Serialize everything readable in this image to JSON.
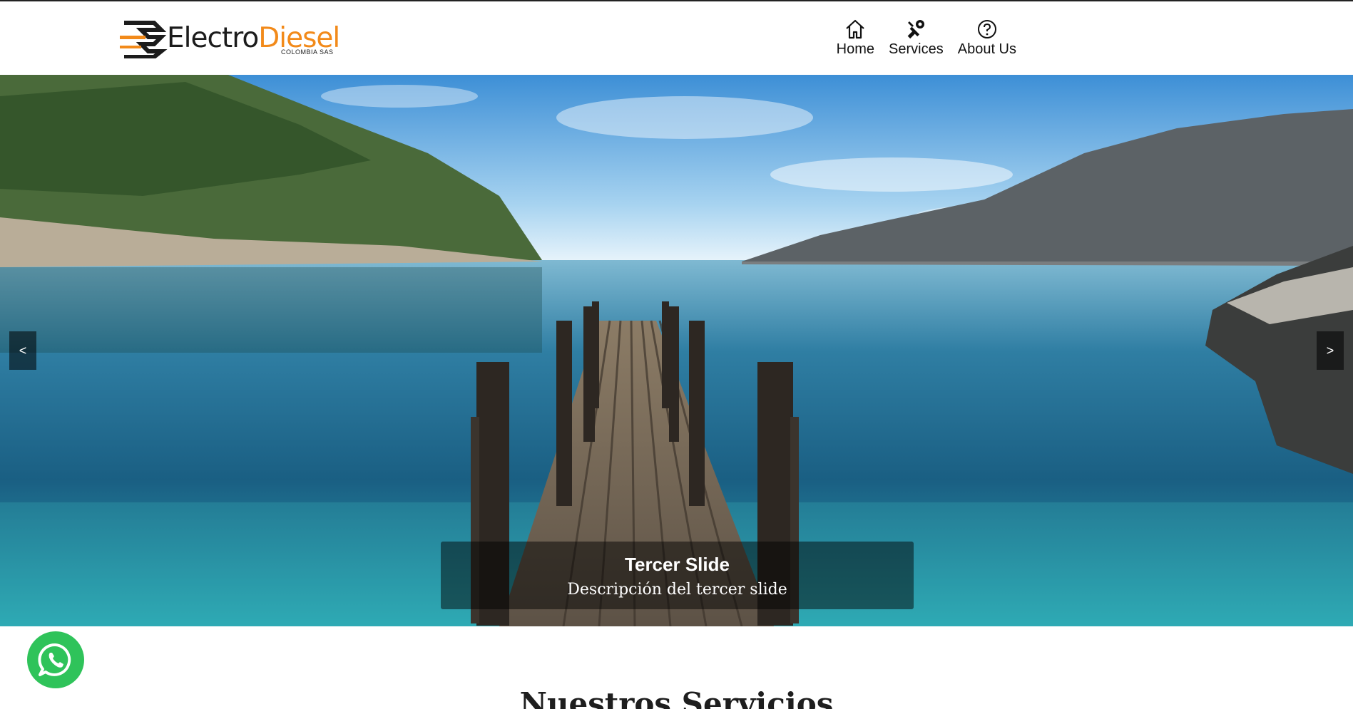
{
  "brand": {
    "name_part1": "Electro",
    "name_part2": "Diesel",
    "subtitle": "COLOMBIA SAS",
    "accent_color": "#f28a1a"
  },
  "nav": {
    "items": [
      {
        "label": "Home",
        "icon": "home-icon"
      },
      {
        "label": "Services",
        "icon": "tools-icon"
      },
      {
        "label": "About Us",
        "icon": "question-circle-icon"
      }
    ]
  },
  "carousel": {
    "prev_label": "<",
    "next_label": ">",
    "caption_title": "Tercer Slide",
    "caption_desc": "Descripción del tercer slide"
  },
  "whatsapp": {
    "icon": "whatsapp-icon",
    "color": "#2fc35a"
  },
  "section": {
    "title": "Nuestros Servicios"
  }
}
